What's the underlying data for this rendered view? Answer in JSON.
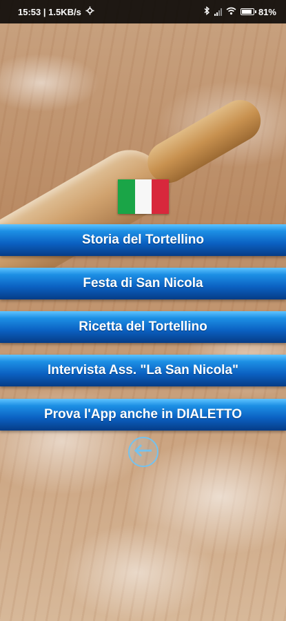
{
  "status_bar": {
    "time_and_speed": "15:53 | 1.5KB/s",
    "battery": "81",
    "icons": [
      "settings-icon",
      "bluetooth-icon",
      "signal-icon",
      "wifi-icon",
      "battery-icon"
    ]
  },
  "flag": {
    "name": "Italian flag",
    "colors": [
      "#1aa547",
      "#f7f7f7",
      "#d8283c"
    ]
  },
  "menu": {
    "items": [
      {
        "label": "Storia del Tortellino"
      },
      {
        "label": "Festa di San Nicola"
      },
      {
        "label": "Ricetta del Tortellino"
      },
      {
        "label": "Intervista Ass. \"La San Nicola\""
      },
      {
        "label": "Prova l'App anche in DIALETTO"
      }
    ],
    "accent": "#0b61c2"
  },
  "back": {
    "icon": "back-arrow-icon"
  }
}
